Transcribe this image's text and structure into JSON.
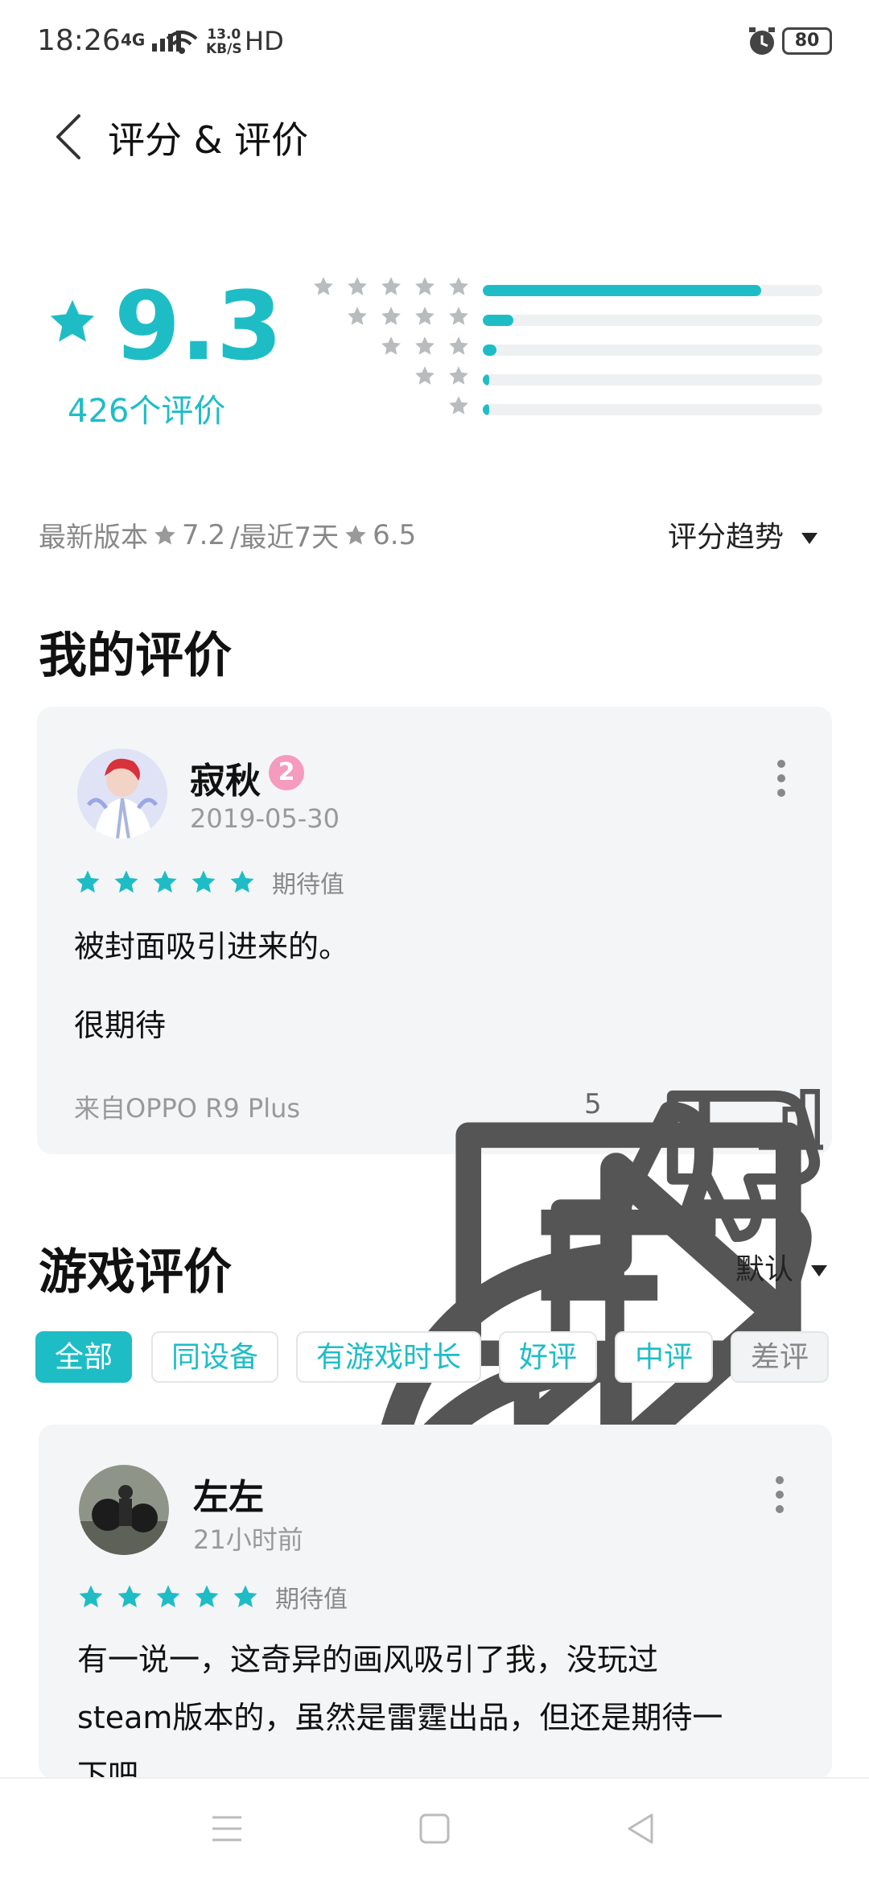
{
  "status_bar": {
    "time": "18:26",
    "network": "4G",
    "speed": "13.0",
    "speed_unit": "KB/S",
    "hd": "HD",
    "battery": "80"
  },
  "header": {
    "title": "评分 & 评价"
  },
  "rating": {
    "score": "9.3",
    "count_label": "426个评价",
    "distribution": [
      {
        "stars": 5,
        "fraction": 0.82
      },
      {
        "stars": 4,
        "fraction": 0.09
      },
      {
        "stars": 3,
        "fraction": 0.04
      },
      {
        "stars": 2,
        "fraction": 0.01
      },
      {
        "stars": 1,
        "fraction": 0.02
      }
    ],
    "latest_label": "最新版本",
    "latest_score": "7.2",
    "recent_label": "/最近7天",
    "recent_score": "6.5",
    "trend_label": "评分趋势"
  },
  "my_review": {
    "section_title": "我的评价",
    "user": "寂秋",
    "level": "2",
    "date": "2019-05-30",
    "stars": 5,
    "tag": "期待值",
    "text1": "被封面吸引进来的。",
    "text2": "很期待",
    "device": "来自OPPO R9 Plus",
    "likes": "5"
  },
  "game_reviews": {
    "section_title": "游戏评价",
    "sort_label": "默认",
    "filters": [
      "全部",
      "同设备",
      "有游戏时长",
      "好评",
      "中评",
      "差评"
    ],
    "first": {
      "user": "左左",
      "date": "21小时前",
      "stars": 5,
      "tag": "期待值",
      "line1": "有一说一，这奇异的画风吸引了我，没玩过",
      "line2": "steam版本的，虽然是雷霆出品，但还是期待一",
      "line3": "下吧"
    }
  },
  "colors": {
    "accent": "#1ebdc6",
    "card_bg": "#f4f5f7"
  }
}
